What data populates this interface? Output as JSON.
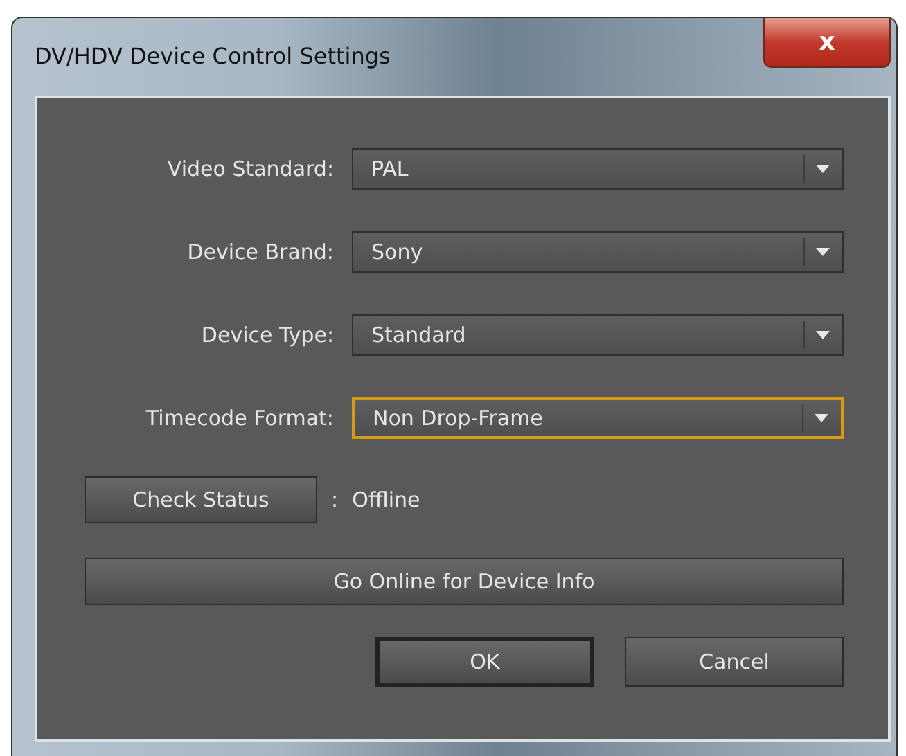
{
  "window": {
    "title": "DV/HDV Device Control Settings",
    "close_label": "x"
  },
  "fields": [
    {
      "label": "Video Standard:",
      "value": "PAL",
      "focused": false
    },
    {
      "label": "Device Brand:",
      "value": "Sony",
      "focused": false
    },
    {
      "label": "Device Type:",
      "value": "Standard",
      "focused": false
    },
    {
      "label": "Timecode Format:",
      "value": "Non Drop-Frame",
      "focused": true
    }
  ],
  "status": {
    "button": "Check Status",
    "separator": ":",
    "value": "Offline"
  },
  "online_button": "Go Online for Device Info",
  "buttons": [
    {
      "label": "OK",
      "default": true
    },
    {
      "label": "Cancel",
      "default": false
    }
  ]
}
